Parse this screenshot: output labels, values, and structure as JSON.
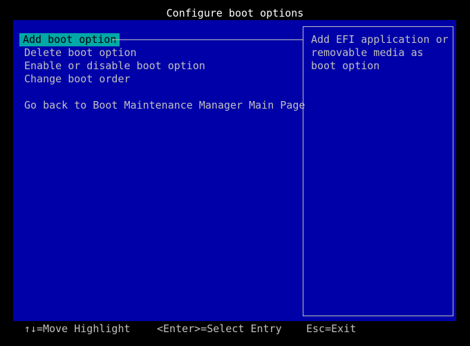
{
  "title": "Configure boot options",
  "menu": {
    "items": [
      {
        "label": "Add boot option",
        "selected": true
      },
      {
        "label": "Delete boot option",
        "selected": false
      },
      {
        "label": "Enable or disable boot option",
        "selected": false
      },
      {
        "label": "Change boot order",
        "selected": false
      },
      {
        "label": "Go back to Boot Maintenance Manager Main Page",
        "selected": false
      }
    ]
  },
  "help": {
    "lines": [
      "Add EFI application or",
      "removable media as",
      "boot option"
    ]
  },
  "footer": {
    "move": "↑↓=Move Highlight",
    "select": "<Enter>=Select Entry",
    "exit": "Esc=Exit"
  },
  "colors": {
    "background": "#000000",
    "panel": "#0000a8",
    "highlight": "#00a8a8",
    "text": "#c0c0c0",
    "title": "#ffffff"
  }
}
